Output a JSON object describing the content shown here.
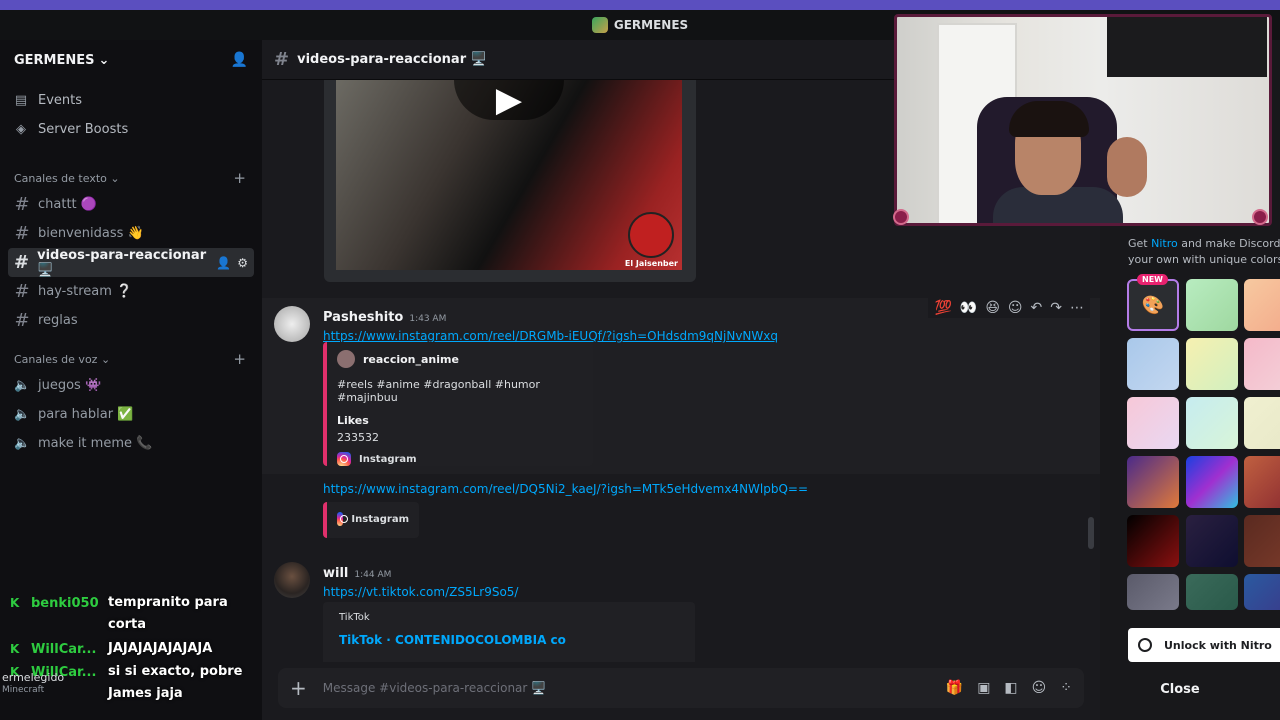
{
  "window": {
    "title": "GERMENES"
  },
  "sidebar": {
    "server_name": "GERMENES",
    "top_items": [
      {
        "label": "Events",
        "icon": "calendar-icon"
      },
      {
        "label": "Server Boosts",
        "icon": "boost-icon"
      }
    ],
    "text_category": "Canales de texto",
    "text_channels": [
      {
        "label": "chattt 🟣"
      },
      {
        "label": "bienvenidass 👋"
      },
      {
        "label": "videos-para-reaccionar 🖥️",
        "active": true
      },
      {
        "label": "hay-stream ❔"
      },
      {
        "label": "reglas"
      }
    ],
    "voice_category": "Canales de voz",
    "voice_channels": [
      {
        "label": "juegos 👾"
      },
      {
        "label": "para hablar ✅"
      },
      {
        "label": "make it meme 📞"
      }
    ],
    "status_user": "ermelegido",
    "status_activity": "Minecraft"
  },
  "chat": {
    "channel_name": "videos-para-reaccionar 🖥️",
    "video_watermark": "El Jaisenber",
    "messages": [
      {
        "author": "Pasheshito",
        "time": "1:43 AM",
        "link": "https://www.instagram.com/reel/DRGMb-iEUQf/?igsh=OHdsdm9qNjNvNWxq",
        "embed": {
          "account": "reaccion_anime",
          "text": "#reels #anime #dragonball #humor #majinbuu",
          "field_name": "Likes",
          "field_value": "233532",
          "provider": "Instagram"
        },
        "link2": "https://www.instagram.com/reel/DQ5Ni2_kaeJ/?igsh=MTk5eHdvemx4NWlpbQ==",
        "embed2_provider": "Instagram"
      },
      {
        "author": "will",
        "time": "1:44 AM",
        "link": "https://vt.tiktok.com/ZS5Lr9So5/",
        "embed": {
          "provider": "TikTok",
          "title": "TikTok · CONTENIDOCOLOMBIA co"
        }
      }
    ],
    "composer_placeholder": "Message #videos-para-reaccionar 🖥️"
  },
  "nitro_panel": {
    "promo_prefix": "Get ",
    "promo_link": "Nitro",
    "promo_suffix": " and make Discord your own with unique colors.",
    "new_badge": "NEW",
    "unlock_label": "Unlock with Nitro",
    "close_label": "Close"
  },
  "stream_chat": [
    {
      "user": "benki050",
      "text": "tempranito para corta"
    },
    {
      "user": "WillCar...",
      "text": "JAJAJAJAJAJAJA"
    },
    {
      "user": "WillCar...",
      "text": "si si exacto, pobre James jaja"
    }
  ]
}
